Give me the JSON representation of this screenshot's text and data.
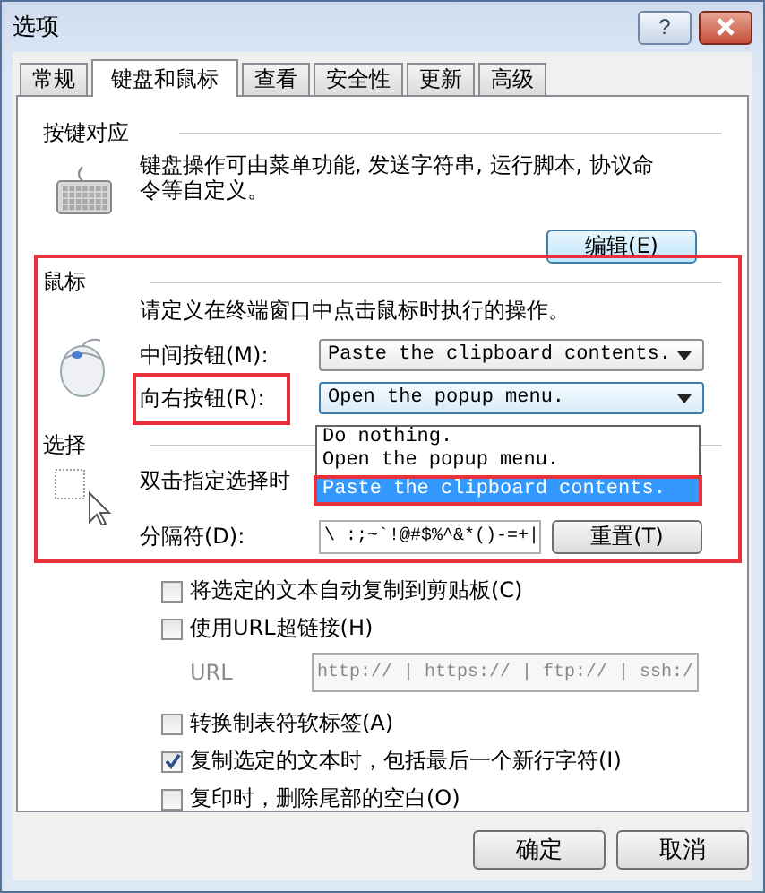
{
  "window": {
    "title": "选项",
    "help_button": "?"
  },
  "tabs": [
    {
      "label": "常规",
      "selected": false
    },
    {
      "label": "键盘和鼠标",
      "selected": true
    },
    {
      "label": "查看",
      "selected": false
    },
    {
      "label": "安全性",
      "selected": false
    },
    {
      "label": "更新",
      "selected": false
    },
    {
      "label": "高级",
      "selected": false
    }
  ],
  "keymap": {
    "heading": "按键对应",
    "description": "键盘操作可由菜单功能, 发送字符串, 运行脚本, 协议命令等自定义。",
    "button": "编辑(E)"
  },
  "mouse": {
    "heading": "鼠标",
    "highlighted": true,
    "description": "请定义在终端窗口中点击鼠标时执行的操作。",
    "rows": [
      {
        "label": "中间按钮(M):",
        "value": "Paste the clipboard contents.",
        "focused": false,
        "highlighted": false
      },
      {
        "label": "向右按钮(R):",
        "value": "Open the popup menu.",
        "focused": true,
        "highlighted": true
      }
    ],
    "dropdown": {
      "items": [
        {
          "label": "Do nothing.",
          "selected": false,
          "highlighted": false
        },
        {
          "label": "Open the popup menu.",
          "selected": false,
          "highlighted": false
        },
        {
          "label": "Paste the clipboard contents.",
          "selected": true,
          "highlighted": true
        }
      ]
    }
  },
  "selection": {
    "heading": "选择",
    "description": "双击指定选择时",
    "separator": {
      "label": "分隔符(D):",
      "value": "\\ :;~`!@#$%^&*()-=+|",
      "button": "重置(T)"
    },
    "options": [
      {
        "kind": "checkbox",
        "label": "将选定的文本自动复制到剪贴板(C)",
        "checked": false
      },
      {
        "kind": "checkbox",
        "label": "使用URL超链接(H)",
        "checked": false
      },
      {
        "kind": "url",
        "label": "URL",
        "value": "http:// | https:// | ftp:// | ssh:/",
        "disabled": true
      },
      {
        "kind": "checkbox",
        "label": "转换制表符软标签(A)",
        "checked": false
      },
      {
        "kind": "checkbox",
        "label": "复制选定的文本时，包括最后一个新行字符(I)",
        "checked": true
      },
      {
        "kind": "checkbox",
        "label": "复印时，删除尾部的空白(O)",
        "checked": false
      }
    ]
  },
  "buttons": [
    "确定",
    "取消"
  ]
}
